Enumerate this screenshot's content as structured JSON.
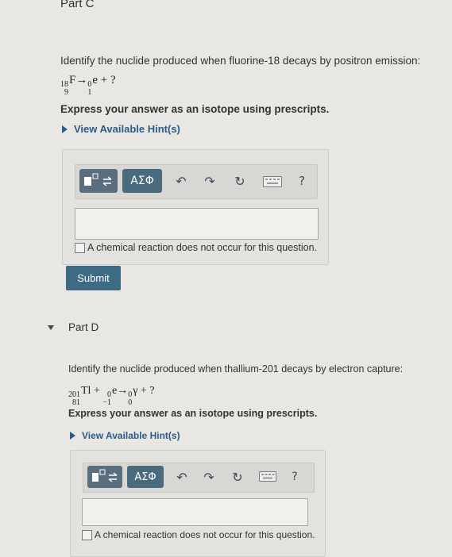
{
  "part_c": {
    "title": "Part C",
    "prompt": "Identify the nuclide produced when fluorine-18 decays by positron emission:",
    "equation": {
      "f_mass": "18",
      "f_num": "9",
      "f_sym": "F",
      "arrow": "→",
      "e_mass": "0",
      "e_num": "1",
      "e_sym": "e",
      "tail": " + ?"
    },
    "express": "Express your answer as an isotope using prescripts.",
    "hint": "View Available Hint(s)",
    "toolbar": {
      "greek": "ΑΣΦ",
      "help": "?"
    },
    "checkbox_label": "A chemical reaction does not occur for this question.",
    "submit": "Submit"
  },
  "part_d": {
    "title": "Part D",
    "prompt": "Identify the nuclide produced when thallium-201 decays by electron capture:",
    "equation": {
      "tl_mass": "201",
      "tl_num": "81",
      "tl_sym": "Tl",
      "plus": " + ",
      "e_mass": "0",
      "e_num": "−1",
      "e_sym": "e",
      "arrow": "→",
      "g_mass": "0",
      "g_num": "0",
      "g_sym": "γ",
      "tail": " + ?"
    },
    "express": "Express your answer as an isotope using prescripts.",
    "hint": "View Available Hint(s)",
    "toolbar": {
      "greek": "ΑΣΦ",
      "help": "?"
    },
    "checkbox_label": "A chemical reaction does not occur for this question."
  }
}
